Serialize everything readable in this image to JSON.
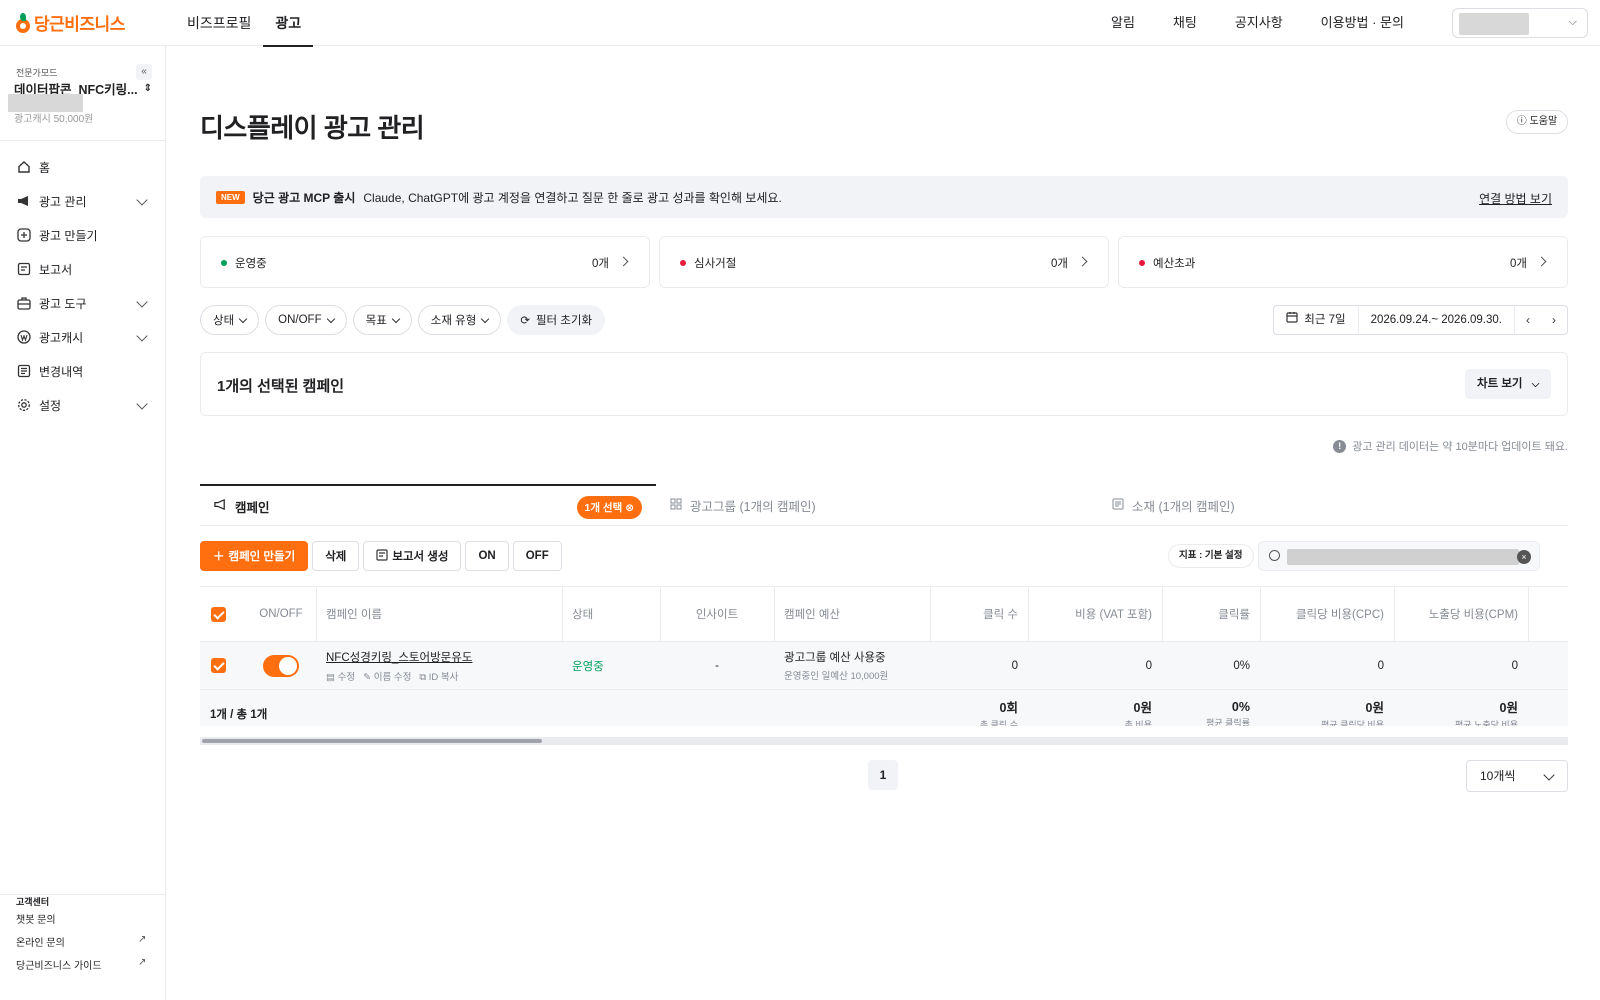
{
  "topbar": {
    "logo": "당근비즈니스",
    "nav": [
      "비즈프로필",
      "광고"
    ],
    "right": [
      "알림",
      "채팅",
      "공지사항",
      "이용방법 · 문의"
    ]
  },
  "sidebar": {
    "mode": "전문가모드",
    "account": "데이터팝콘_NFC키링...",
    "cash": "광고캐시 50,000원",
    "items": [
      {
        "label": "홈"
      },
      {
        "label": "광고 관리"
      },
      {
        "label": "광고 만들기"
      },
      {
        "label": "보고서"
      },
      {
        "label": "광고 도구"
      },
      {
        "label": "광고캐시"
      },
      {
        "label": "변경내역"
      },
      {
        "label": "설정"
      }
    ],
    "footer_title": "고객센터",
    "footer_links": [
      "챗봇 문의",
      "온라인 문의",
      "당근비즈니스 가이드"
    ]
  },
  "page": {
    "title": "디스플레이 광고 관리",
    "help": "도움말"
  },
  "banner": {
    "badge": "NEW",
    "title": "당근 광고 MCP 출시",
    "text": "Claude, ChatGPT에 광고 계정을 연결하고 질문 한 줄로 광고 성과를 확인해 보세요.",
    "link": "연결 방법 보기"
  },
  "stats": [
    {
      "label": "운영중",
      "count": "0개",
      "color": "#00a05b"
    },
    {
      "label": "심사거절",
      "count": "0개",
      "color": "#e8193d"
    },
    {
      "label": "예산초과",
      "count": "0개",
      "color": "#e8193d"
    }
  ],
  "filters": [
    "상태",
    "ON/OFF",
    "목표",
    "소재 유형"
  ],
  "filter_reset": "필터 초기화",
  "date": {
    "preset": "최근 7일",
    "range": "2026.09.24.~ 2026.09.30."
  },
  "selected_card": {
    "title": "1개의 선택된 캠페인",
    "chart_button": "차트 보기"
  },
  "update_note": "광고 관리 데이터는 약 10분마다 업데이트 돼요.",
  "tabs": [
    {
      "label": "캠페인",
      "pill": "1개 선택"
    },
    {
      "label": "광고그룹 (1개의 캠페인)"
    },
    {
      "label": "소재 (1개의 캠페인)"
    }
  ],
  "actions": {
    "create": "캠페인 만들기",
    "delete": "삭제",
    "report": "보고서 생성",
    "on": "ON",
    "off": "OFF",
    "metric": "지표 : 기본 설정"
  },
  "table": {
    "headers": [
      "ON/OFF",
      "캠페인 이름",
      "상태",
      "인사이트",
      "캠페인 예산",
      "클릭 수",
      "비용 (VAT 포함)",
      "클릭률",
      "클릭당 비용(CPC)",
      "노출당 비용(CPM)"
    ],
    "row": {
      "name": "NFC성경키링_스토어방문유도",
      "acts": [
        "수정",
        "이름 수정",
        "ID 복사"
      ],
      "status": "운영중",
      "insight": "-",
      "budget": "광고그룹 예산 사용중",
      "budget_sub": "운영중인 일예산 10,000원",
      "clicks": "0",
      "cost": "0",
      "ctr": "0%",
      "cpc": "0",
      "cpm": "0"
    },
    "footer": {
      "count": "1개 / 총 1개",
      "clicks": "0회",
      "clicks_sub": "총 클릭 수",
      "cost": "0원",
      "cost_sub": "총 비용",
      "ctr": "0%",
      "ctr_sub": "평균 클릭률",
      "cpc": "0원",
      "cpc_sub": "평균 클릭당 비용",
      "cpm": "0원",
      "cpm_sub": "평균 노출당 비용"
    }
  },
  "pagination": {
    "page": "1",
    "size": "10개씩"
  }
}
